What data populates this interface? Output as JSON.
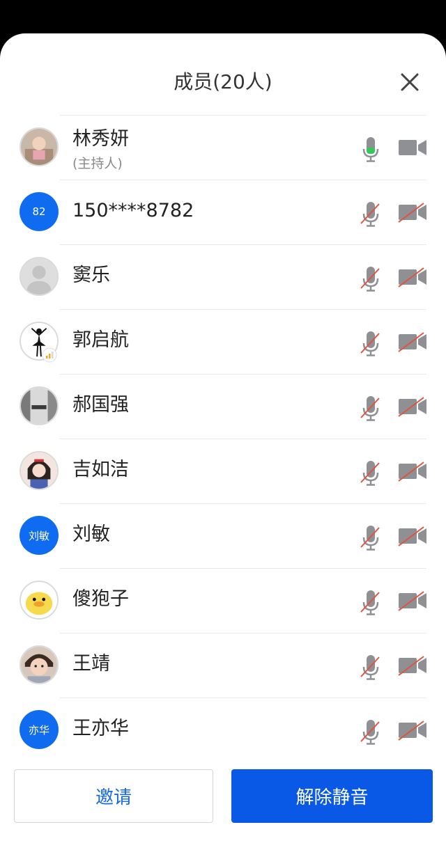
{
  "header": {
    "title": "成员(20人)",
    "close_icon": "close-icon"
  },
  "colors": {
    "accent_blue": "#0f6bf0",
    "button_blue": "#0a58e6",
    "link_blue": "#1769e6",
    "icon_gray": "#8e9094",
    "mute_slash_red": "#e0533f",
    "active_green": "#34c759"
  },
  "members": [
    {
      "name": "林秀妍",
      "sub": "(主持人)",
      "avatar_type": "photo",
      "avatar_text": "",
      "mic": "on",
      "camera": "off-plain"
    },
    {
      "name": "150****8782",
      "sub": "",
      "avatar_type": "initials",
      "avatar_text": "82",
      "mic": "muted",
      "camera": "off"
    },
    {
      "name": "窦乐",
      "sub": "",
      "avatar_type": "default",
      "avatar_text": "",
      "mic": "muted",
      "camera": "off"
    },
    {
      "name": "郭启航",
      "sub": "",
      "avatar_type": "photo",
      "avatar_text": "",
      "mic": "muted",
      "camera": "off"
    },
    {
      "name": "郝国强",
      "sub": "",
      "avatar_type": "photo",
      "avatar_text": "",
      "mic": "muted",
      "camera": "off"
    },
    {
      "name": "吉如洁",
      "sub": "",
      "avatar_type": "photo",
      "avatar_text": "",
      "mic": "muted",
      "camera": "off"
    },
    {
      "name": "刘敏",
      "sub": "",
      "avatar_type": "initials",
      "avatar_text": "刘敏",
      "mic": "muted",
      "camera": "off"
    },
    {
      "name": "傻狍子",
      "sub": "",
      "avatar_type": "photo",
      "avatar_text": "",
      "mic": "muted",
      "camera": "off"
    },
    {
      "name": "王靖",
      "sub": "",
      "avatar_type": "photo",
      "avatar_text": "",
      "mic": "muted",
      "camera": "off"
    },
    {
      "name": "王亦华",
      "sub": "",
      "avatar_type": "initials",
      "avatar_text": "亦华",
      "mic": "muted",
      "camera": "off"
    }
  ],
  "footer": {
    "invite_label": "邀请",
    "unmute_label": "解除静音"
  }
}
